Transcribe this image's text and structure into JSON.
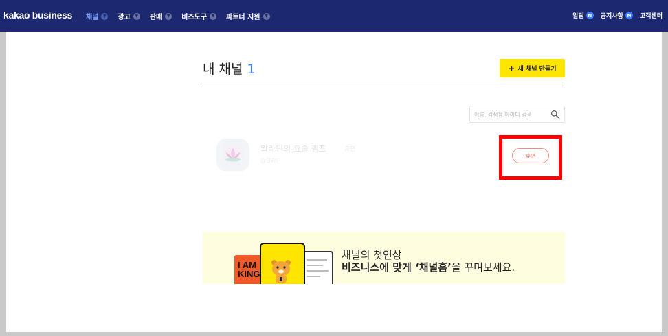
{
  "brand": "kakao business",
  "nav": [
    {
      "label": "채널",
      "active": true
    },
    {
      "label": "광고",
      "active": false
    },
    {
      "label": "판매",
      "active": false
    },
    {
      "label": "비즈도구",
      "active": false
    },
    {
      "label": "파트너 지원",
      "active": false
    }
  ],
  "right_nav": {
    "alerts": "알림",
    "alerts_badge": "N",
    "notice": "공지사항",
    "notice_badge": "N",
    "support": "고객센터"
  },
  "page": {
    "title": "내 채널",
    "count": "1",
    "new_channel": "새 채널 만들기",
    "search_placeholder": "이름, 검색용 아이디 검색"
  },
  "channel": {
    "name": "알라딘의 요술 램프",
    "tag": "휴면",
    "sub": "@알라딘",
    "status_button": "휴면"
  },
  "banner": {
    "line1": "채널의 첫인상",
    "line2_bold": "비즈니스에 맞게 ‘채널홈’",
    "line2_rest": "을 꾸며보세요.",
    "art_text": "I AM KING"
  },
  "colors": {
    "topbar": "#1c2970",
    "active_nav": "#7fa6ff",
    "badge": "#3b7cff",
    "primary_button": "#fee500",
    "dormant": "#e97161",
    "highlight": "#ff0000",
    "banner": "#fffde0"
  }
}
